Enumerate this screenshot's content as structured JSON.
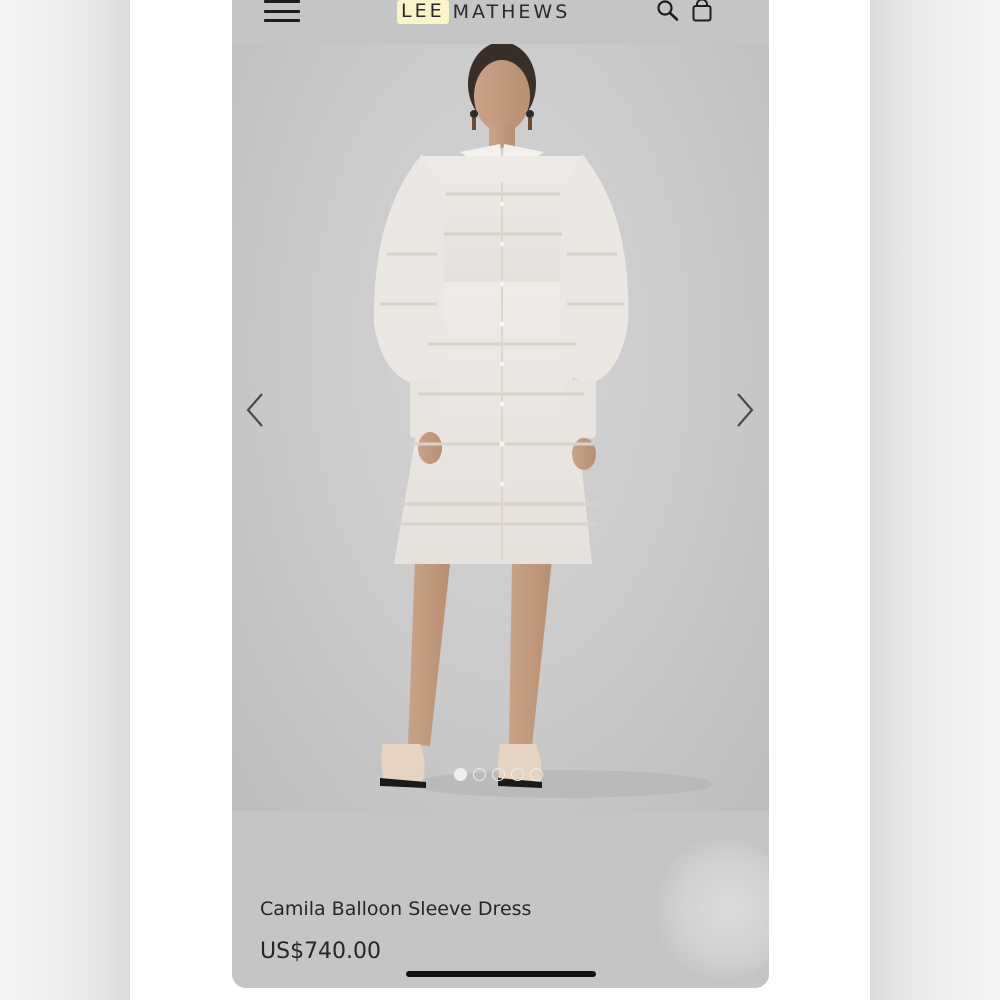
{
  "brand": {
    "highlight": "LEE",
    "rest": "MATHEWS"
  },
  "header": {
    "menu_icon": "hamburger-menu-icon",
    "search_icon": "search-icon",
    "bag_icon": "shopping-bag-icon"
  },
  "gallery": {
    "prev_icon": "chevron-left-icon",
    "next_icon": "chevron-right-icon",
    "image_count": 5,
    "active_index": 0
  },
  "product": {
    "name": "Camila Balloon Sleeve Dress",
    "price": "US$740.00"
  },
  "colors": {
    "header_bg": "#c5c5c5",
    "brand_highlight": "#fbf4c6",
    "text": "#262626"
  }
}
